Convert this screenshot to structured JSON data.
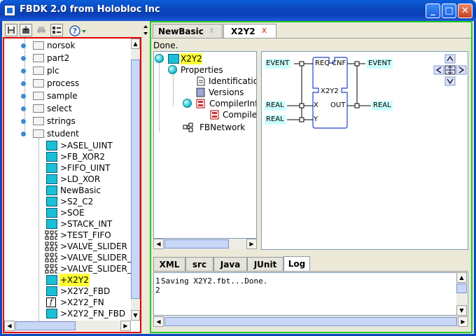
{
  "window": {
    "title": "FBDK 2.0 from Holobloc Inc"
  },
  "tree": {
    "items": [
      {
        "label": "norsok",
        "type": "folder"
      },
      {
        "label": "part2",
        "type": "folder"
      },
      {
        "label": "plc",
        "type": "folder"
      },
      {
        "label": "process",
        "type": "folder"
      },
      {
        "label": "sample",
        "type": "folder"
      },
      {
        "label": "select",
        "type": "folder"
      },
      {
        "label": "strings",
        "type": "folder"
      },
      {
        "label": "student",
        "type": "folder"
      },
      {
        "label": ">ASEL_UINT",
        "type": "fb"
      },
      {
        "label": ">FB_XOR2",
        "type": "fb"
      },
      {
        "label": ">FIFO_UINT",
        "type": "fb"
      },
      {
        "label": ">LD_XOR",
        "type": "fb"
      },
      {
        "label": "NewBasic",
        "type": "fb"
      },
      {
        "label": ">S2_C2",
        "type": "fb"
      },
      {
        "label": ">SOE",
        "type": "fb"
      },
      {
        "label": ">STACK_INT",
        "type": "fb"
      },
      {
        "label": ">TEST_FIFO",
        "type": "net"
      },
      {
        "label": ">VALVE_SLIDER",
        "type": "net"
      },
      {
        "label": ">VALVE_SLIDER_",
        "type": "net"
      },
      {
        "label": ">VALVE_SLIDER_",
        "type": "net"
      },
      {
        "label": "+X2Y2",
        "type": "fb"
      },
      {
        "label": ">X2Y2_FBD",
        "type": "fb"
      },
      {
        "label": ">X2Y2_FN",
        "type": "fn"
      },
      {
        "label": ">X2Y2_FN_FBD",
        "type": "fb"
      }
    ]
  },
  "editor": {
    "tabs": [
      {
        "label": "NewBasic",
        "close": "X"
      },
      {
        "label": "X2Y2",
        "close": "X"
      }
    ],
    "status": "Done.",
    "structure": {
      "root": "X2Y2",
      "properties": "Properties",
      "identification": "Identification",
      "versions": "Versions",
      "compiler_info": "CompilerInfo",
      "compiler": "Compiler",
      "fbnetwork": "FBNetwork"
    },
    "diagram": {
      "block_name": "X2Y2",
      "event_in": "EVENT",
      "event_out": "EVENT",
      "req": "REQ",
      "cnf": "CNF",
      "x": "X",
      "y": "Y",
      "out": "OUT",
      "real_in_1": "REAL",
      "real_in_2": "REAL",
      "real_out": "REAL"
    }
  },
  "bottom_tabs": [
    "XML",
    "src",
    "Java",
    "JUnit",
    "Log"
  ],
  "log": {
    "line_numbers": [
      "1",
      "2"
    ],
    "lines": [
      "Saving X2Y2.fbt...Done.",
      ""
    ]
  }
}
